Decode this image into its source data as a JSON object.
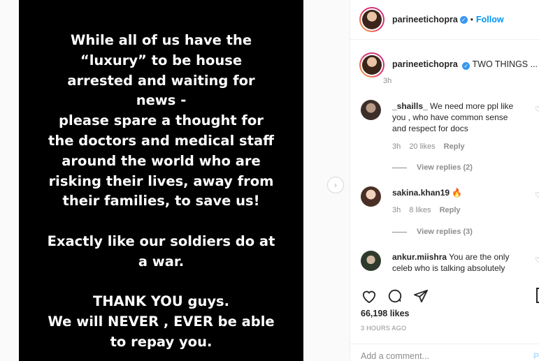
{
  "media": {
    "lines": [
      "While all of us have the",
      "“luxury” to be house",
      "arrested and waiting for",
      "news -",
      "please spare a thought for",
      "the doctors and medical staff",
      "around the world who are",
      "risking their lives, away from",
      "their families, to save us!",
      "",
      "Exactly like our soldiers do at",
      "a war.",
      "",
      "THANK YOU guys.",
      "We will NEVER , EVER be able",
      "to repay you."
    ]
  },
  "header": {
    "username": "parineetichopra",
    "follow_label": "Follow",
    "separator": "•"
  },
  "caption": {
    "username": "parineetichopra",
    "text": "TWO THINGS ...",
    "time": "3h"
  },
  "comments": [
    {
      "username": "_shaills_",
      "text": "We need more ppl like you , who have common sense and respect for docs",
      "time": "3h",
      "likes": "20 likes",
      "reply_label": "Reply",
      "view_replies": "View replies (2)"
    },
    {
      "username": "sakina.khan19",
      "text": "🔥",
      "time": "3h",
      "likes": "8 likes",
      "reply_label": "Reply",
      "view_replies": "View replies (3)"
    },
    {
      "username": "ankur.miishra",
      "text": "You are the only celeb who is talking absolutely",
      "time": "",
      "likes": "",
      "reply_label": "",
      "view_replies": ""
    }
  ],
  "stats": {
    "likes": "66,198 likes",
    "time_ago": "3 HOURS AGO"
  },
  "add_comment": {
    "placeholder": "Add a comment...",
    "post_label": "P"
  },
  "icons": {
    "verified": "verified-badge-icon",
    "like": "heart-icon",
    "comment": "comment-icon",
    "share": "share-icon",
    "next": "chevron-right-icon"
  },
  "colors": {
    "accent": "#0095f6",
    "verified": "#3897f0",
    "muted": "#8e8e8e"
  }
}
